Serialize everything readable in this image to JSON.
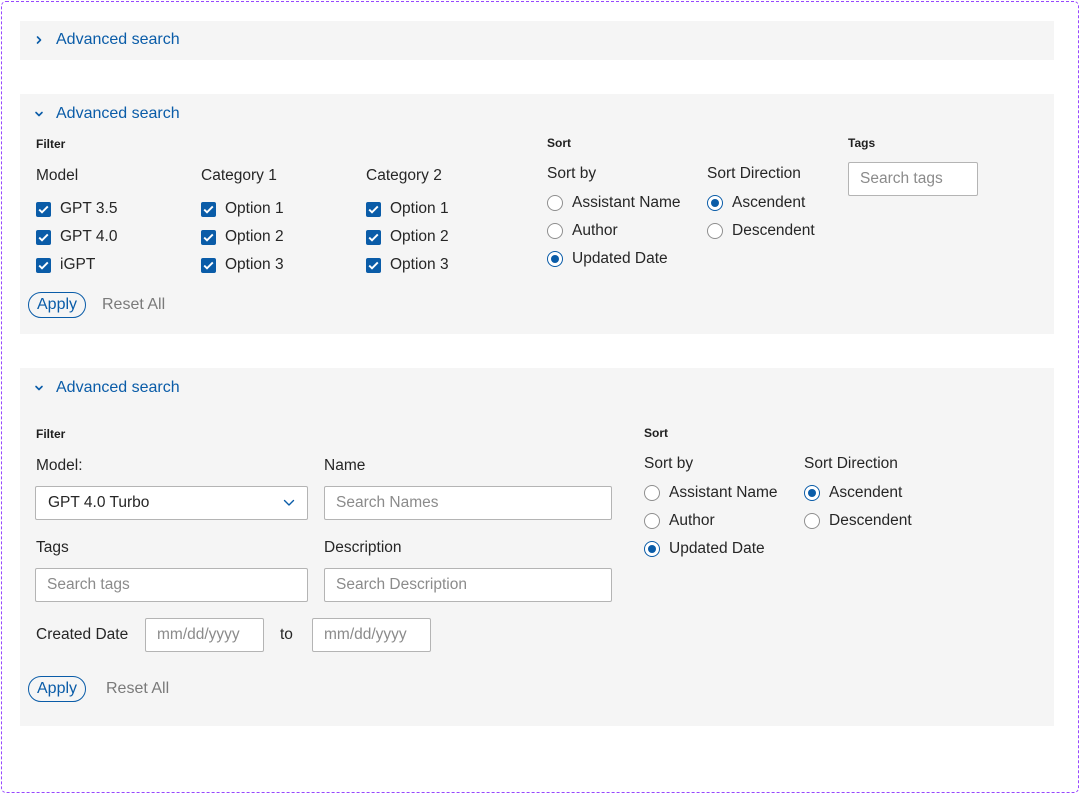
{
  "panel_collapsed": {
    "toggle_label": "Advanced search"
  },
  "panel_compact": {
    "toggle_label": "Advanced search",
    "filter_title": "Filter",
    "columns": [
      {
        "title": "Model",
        "options": [
          {
            "label": "GPT 3.5",
            "checked": true
          },
          {
            "label": "GPT 4.0",
            "checked": true
          },
          {
            "label": "iGPT",
            "checked": true
          }
        ]
      },
      {
        "title": "Category 1",
        "options": [
          {
            "label": "Option 1",
            "checked": true
          },
          {
            "label": "Option 2",
            "checked": true
          },
          {
            "label": "Option 3",
            "checked": true
          }
        ]
      },
      {
        "title": "Category 2",
        "options": [
          {
            "label": "Option 1",
            "checked": true
          },
          {
            "label": "Option 2",
            "checked": true
          },
          {
            "label": "Option 3",
            "checked": true
          }
        ]
      }
    ],
    "sort_title": "Sort",
    "sort_by_title": "Sort by",
    "sort_by_options": [
      "Assistant Name",
      "Author",
      "Updated Date"
    ],
    "sort_by_selected": "Updated Date",
    "sort_direction_title": "Sort Direction",
    "sort_direction_options": [
      "Ascendent",
      "Descendent"
    ],
    "sort_direction_selected": "Ascendent",
    "tags_title": "Tags",
    "tags_placeholder": "Search tags",
    "apply_label": "Apply",
    "reset_label": "Reset All"
  },
  "panel_expanded": {
    "toggle_label": "Advanced search",
    "filter_title": "Filter",
    "model_label": "Model:",
    "model_value": "GPT 4.0 Turbo",
    "name_label": "Name",
    "name_placeholder": "Search Names",
    "tags_label": "Tags",
    "tags_placeholder": "Search tags",
    "description_label": "Description",
    "description_placeholder": "Search Description",
    "created_date_label": "Created Date",
    "date_from_placeholder": "mm/dd/yyyy",
    "date_to_label": "to",
    "date_to_placeholder": "mm/dd/yyyy",
    "sort_title": "Sort",
    "sort_by_title": "Sort by",
    "sort_by_options": [
      "Assistant Name",
      "Author",
      "Updated Date"
    ],
    "sort_by_selected": "Updated Date",
    "sort_direction_title": "Sort Direction",
    "sort_direction_options": [
      "Ascendent",
      "Descendent"
    ],
    "sort_direction_selected": "Ascendent",
    "apply_label": "Apply",
    "reset_label": "Reset All"
  },
  "colors": {
    "accent": "#0a5ca8",
    "panel_bg": "#f5f5f5",
    "frame_border": "#9747ff",
    "muted_text": "#7a7a7a"
  }
}
